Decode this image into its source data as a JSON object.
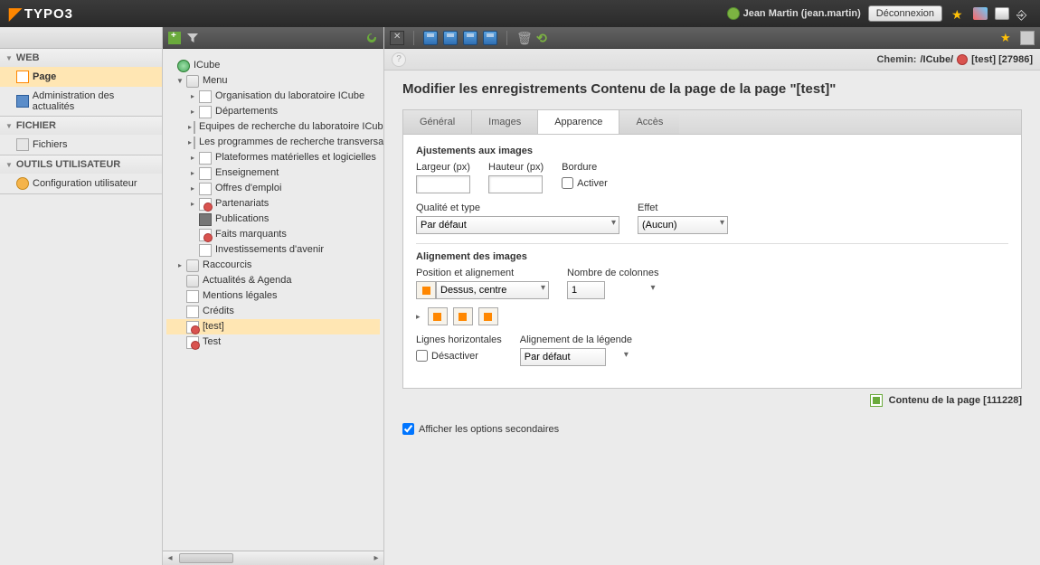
{
  "topbar": {
    "brand": "TYPO3",
    "user_name": "Jean Martin (jean.martin)",
    "logout_label": "Déconnexion"
  },
  "modules": {
    "groups": [
      {
        "title": "WEB",
        "items": [
          {
            "label": "Page",
            "active": true,
            "icon": "page"
          },
          {
            "label": "Administration des actualités",
            "icon": "news"
          }
        ]
      },
      {
        "title": "FICHIER",
        "items": [
          {
            "label": "Fichiers",
            "icon": "files"
          }
        ]
      },
      {
        "title": "OUTILS UTILISATEUR",
        "items": [
          {
            "label": "Configuration utilisateur",
            "icon": "user"
          }
        ]
      }
    ]
  },
  "tree": {
    "root": "ICube",
    "menu_label": "Menu",
    "items": [
      "Organisation du laboratoire ICube",
      "Départements",
      "Equipes de recherche du laboratoire ICube",
      "Les programmes de recherche transversaux",
      "Plateformes matérielles et logicielles",
      "Enseignement",
      "Offres d'emploi",
      "Partenariats",
      "Publications",
      "Faits marquants",
      "Investissements d'avenir"
    ],
    "raccourcis": "Raccourcis",
    "actus": "Actualités & Agenda",
    "mentions": "Mentions légales",
    "credits": "Crédits",
    "test_sel": "[test]",
    "test": "Test"
  },
  "path": {
    "label": "Chemin:",
    "root": "/ICube/",
    "page": "[test] [27986]"
  },
  "title": "Modifier les enregistrements Contenu de la page de la page \"[test]\"",
  "tabs": {
    "general": "Général",
    "images": "Images",
    "appearance": "Apparence",
    "access": "Accès"
  },
  "form": {
    "sec1": "Ajustements aux images",
    "width_label": "Largeur (px)",
    "height_label": "Hauteur (px)",
    "border_label": "Bordure",
    "border_activate": "Activer",
    "quality_label": "Qualité et type",
    "quality_value": "Par défaut",
    "effect_label": "Effet",
    "effect_value": "(Aucun)",
    "sec2": "Alignement des images",
    "pos_label": "Position et alignement",
    "pos_value": "Dessus, centre",
    "cols_label": "Nombre de colonnes",
    "cols_value": "1",
    "hr_label": "Lignes horizontales",
    "hr_deactivate": "Désactiver",
    "legend_label": "Alignement de la légende",
    "legend_value": "Par défaut"
  },
  "footer": {
    "content_label": "Contenu de la page",
    "content_id": "[111228]"
  },
  "secondary_label": "Afficher les options secondaires"
}
